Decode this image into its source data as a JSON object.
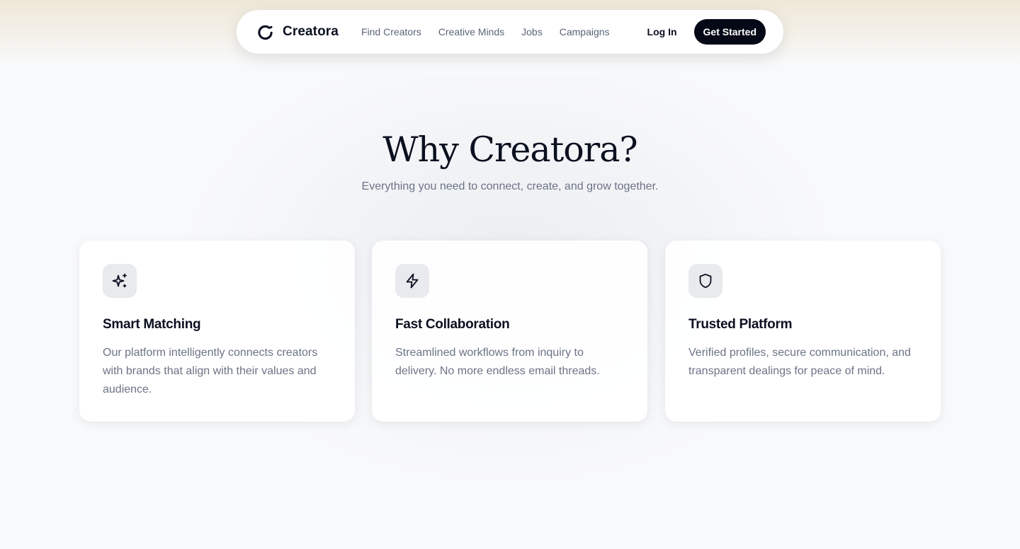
{
  "nav": {
    "brand": "Creatora",
    "links": [
      "Find Creators",
      "Creative Minds",
      "Jobs",
      "Campaigns"
    ],
    "login": "Log In",
    "cta": "Get Started"
  },
  "hero": {
    "title": "Why Creatora?",
    "subtitle": "Everything you need to connect, create, and grow together."
  },
  "features": [
    {
      "icon": "sparkles-icon",
      "title": "Smart Matching",
      "text": "Our platform intelligently connects creators with brands that align with their values and audience."
    },
    {
      "icon": "lightning-icon",
      "title": "Fast Collaboration",
      "text": "Streamlined workflows from inquiry to delivery. No more endless email threads."
    },
    {
      "icon": "shield-icon",
      "title": "Trusted Platform",
      "text": "Verified profiles, secure communication, and transparent dealings for peace of mind."
    }
  ],
  "colors": {
    "primary": "#050816",
    "text": "#0b1020",
    "muted": "#6b7386",
    "background": "#f8f9fb",
    "icon_bg": "#e9eaee"
  }
}
